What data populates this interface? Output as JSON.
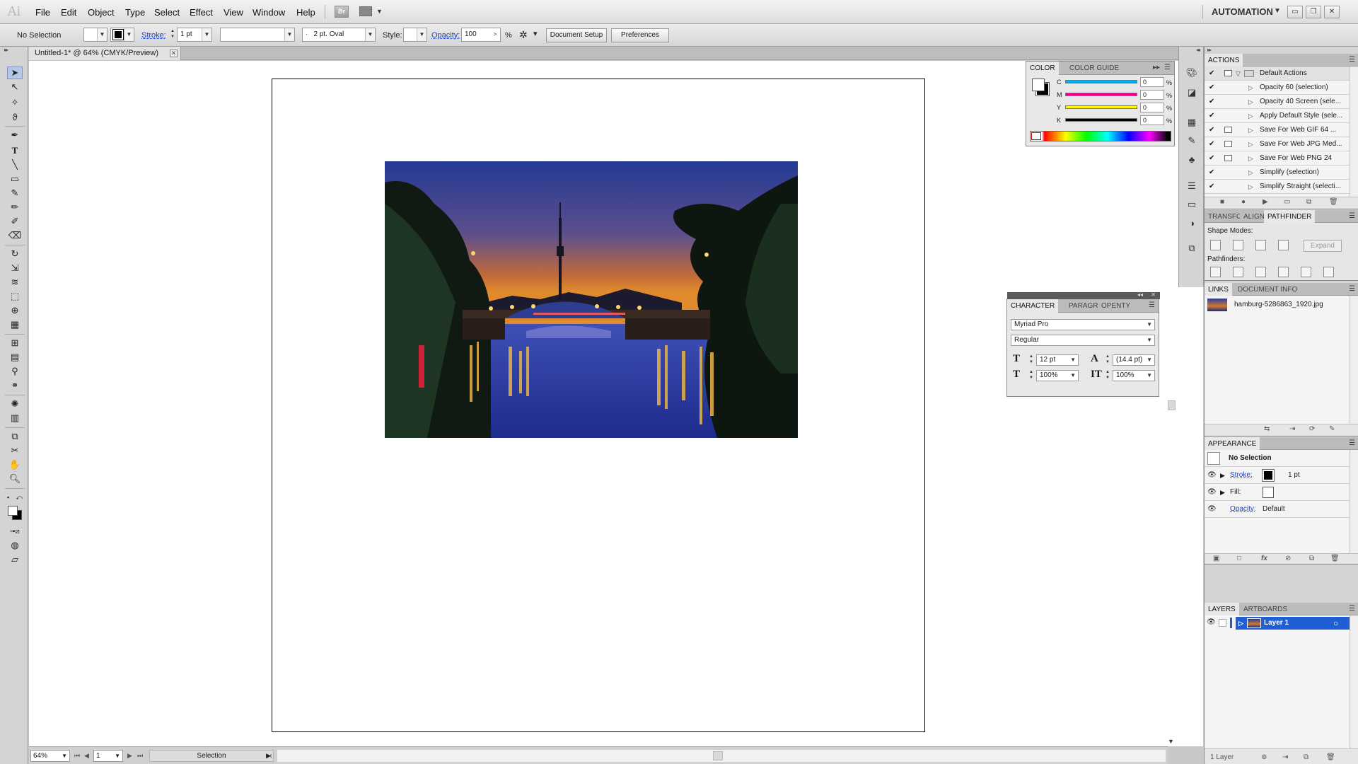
{
  "app": {
    "logo": "Ai",
    "workspace": "AUTOMATION",
    "bridge_label": "Br"
  },
  "menu": [
    "File",
    "Edit",
    "Object",
    "Type",
    "Select",
    "Effect",
    "View",
    "Window",
    "Help"
  ],
  "window_buttons": {
    "minimize": "▭",
    "restore": "❐",
    "close": "✕"
  },
  "control_bar": {
    "selection": "No Selection",
    "stroke_label": "Stroke:",
    "stroke_weight": "1 pt",
    "brush": "2 pt. Oval",
    "style_label": "Style:",
    "opacity_label": "Opacity:",
    "opacity_value": "100",
    "opacity_unit": "%",
    "document_setup": "Document Setup",
    "preferences": "Preferences"
  },
  "document": {
    "tab_title": "Untitled-1* @ 64% (CMYK/Preview)"
  },
  "status": {
    "zoom": "64%",
    "page": "1",
    "tool": "Selection"
  },
  "color_panel": {
    "tabs": [
      "COLOR",
      "COLOR GUIDE"
    ],
    "channels": [
      {
        "label": "C",
        "value": "0",
        "color": "#00aeef"
      },
      {
        "label": "M",
        "value": "0",
        "color": "#ec008c"
      },
      {
        "label": "Y",
        "value": "0",
        "color": "#fff200"
      },
      {
        "label": "K",
        "value": "0",
        "color": "#000000"
      }
    ],
    "unit": "%"
  },
  "character_panel": {
    "tabs": [
      "CHARACTER",
      "PARAGR",
      "OPENTY"
    ],
    "font_family": "Myriad Pro",
    "font_style": "Regular",
    "font_size": "12 pt",
    "leading": "(14.4 pt)",
    "vertical_scale": "100%",
    "horizontal_scale": "100%"
  },
  "actions_panel": {
    "title": "ACTIONS",
    "set_name": "Default Actions",
    "items": [
      "Opacity 60 (selection)",
      "Opacity 40 Screen (sele...",
      "Apply Default Style (sele...",
      "Save For Web GIF 64 ...",
      "Save For Web JPG Med...",
      "Save For Web PNG 24",
      "Simplify (selection)",
      "Simplify Straight (selecti..."
    ]
  },
  "pathfinder_panel": {
    "tabs": [
      "TRANSFORM",
      "ALIGN",
      "PATHFINDER"
    ],
    "shape_modes": "Shape Modes:",
    "expand": "Expand",
    "pathfinders": "Pathfinders:"
  },
  "links_panel": {
    "tabs": [
      "LINKS",
      "DOCUMENT INFO"
    ],
    "file": "hamburg-5286863_1920.jpg"
  },
  "appearance_panel": {
    "title": "APPEARANCE",
    "header": "No Selection",
    "stroke_label": "Stroke:",
    "stroke_value": "1 pt",
    "fill_label": "Fill:",
    "opacity_label": "Opacity:",
    "opacity_value": "Default"
  },
  "layers_panel": {
    "tabs": [
      "LAYERS",
      "ARTBOARDS"
    ],
    "layer_name": "Layer 1",
    "footer": "1 Layer",
    "highlight": "#1f5fd6"
  }
}
